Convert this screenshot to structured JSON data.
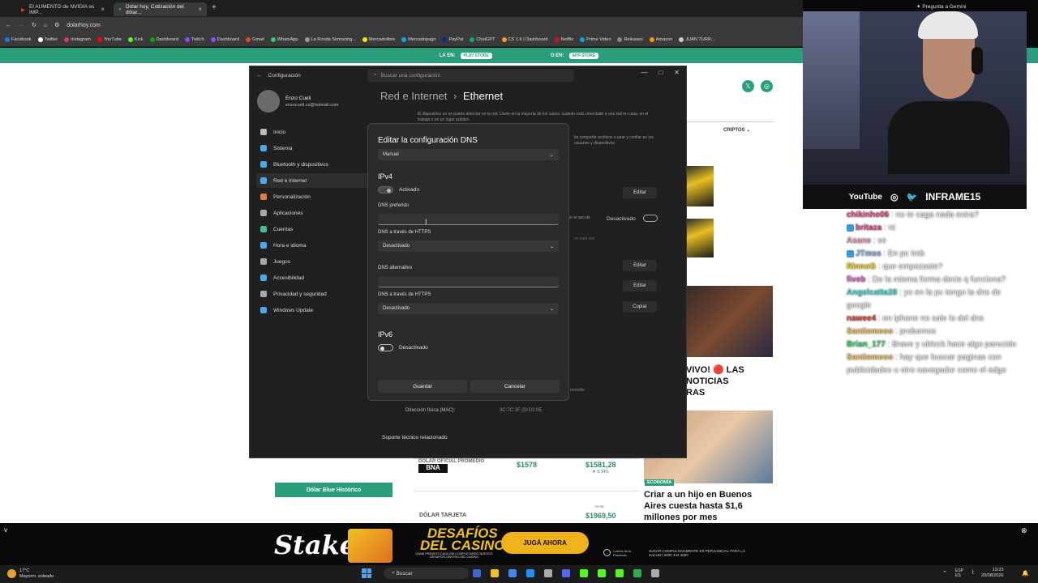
{
  "browser": {
    "tabs": [
      {
        "label": "El AUMENTO de NVIDIA es IMP..."
      },
      {
        "label": "Dólar hoy, Cotización del dólar..."
      }
    ],
    "url": "dolarhoy.com",
    "bookmarks": [
      "Facebook",
      "Twitter",
      "Instagram",
      "YouTube",
      "Kick",
      "Dashboard",
      "Twitch",
      "Dashboard",
      "Gmail",
      "WhatsApp",
      "La Ronda Simracing...",
      "Mercadolibre",
      "Mercadopago",
      "PayPal",
      "ChatGPT",
      "CS 1.6 | Dashboard",
      "Netflix",
      "Prime Video",
      "Releases",
      "Amazon",
      "JUAN TURR..."
    ]
  },
  "website": {
    "banner_left": "LA EN:",
    "banner_left_pill": "PLAY STORE",
    "banner_right": "O EN:",
    "banner_right_pill": "APP STORE",
    "cripto": "CRIPTOS",
    "blue_button": "Dólar Blue Histórico",
    "row1_label": "DÓLAR OFICIAL PROMEDIO",
    "row1_buy": "$1578",
    "row1_sell": "$1581,28",
    "row1_var": "▼ 0.34%",
    "row2_label": "DÓLAR TARJETA",
    "row2_sell_label": "Venta",
    "row2_sell": "$1969,50",
    "news1": "VIVO! 🔴 LAS\nNOTICIAS\nRAS",
    "news2_tag": "ECONOMÍA",
    "news2": "Criar a un hijo en Buenos Aires cuesta hasta $1,6 millones por mes"
  },
  "settings": {
    "app_title": "Configuración",
    "search_placeholder": "Buscar una configuración",
    "user_name": "Enzo Cueli",
    "user_email": "enzocueli.cs@hotmail.com",
    "nav": [
      "Inicio",
      "Sistema",
      "Bluetooth y dispositivos",
      "Red e Internet",
      "Personalización",
      "Aplicaciones",
      "Cuentas",
      "Hora e idioma",
      "Juegos",
      "Accesibilidad",
      "Privacidad y seguridad",
      "Windows Update"
    ],
    "breadcrumb_parent": "Red e Internet",
    "breadcrumb_sep": "›",
    "breadcrumb_current": "Ethernet",
    "bg_text1": "El dispositivo no se puede detectar en la red. Úselo en la mayoría de los casos: cuando está conectado a una red en casa, en el trabajo o en un lugar público.",
    "bg_text2": "ita compartir archivos o usar y confiar en los usuarios y dispositivos",
    "bg_text3": "ucir el uso de",
    "bg_text4": "en esta red",
    "edit_label": "Editar",
    "copy_label": "Copiar",
    "toggle_state": "Desactivado",
    "mac_label": "Dirección física (MAC):",
    "mac_value": "3C:7C:3F:23:D3:0E",
    "controller": "ontroller",
    "support": "Soporte técnico relacionado"
  },
  "dialog": {
    "title": "Editar la configuración DNS",
    "mode": "Manual",
    "ipv4_title": "IPv4",
    "ipv4_state": "Activado",
    "dns_pref_label": "DNS preferido",
    "dns_pref_value": "",
    "https1_label": "DNS a través de HTTPS",
    "https1_value": "Desactivado",
    "dns_alt_label": "DNS alternativo",
    "dns_alt_value": "",
    "https2_label": "DNS a través de HTTPS",
    "https2_value": "Desactivado",
    "ipv6_title": "IPv6",
    "ipv6_state": "Desactivado",
    "save": "Guardar",
    "cancel": "Cancelar"
  },
  "stream": {
    "gemini": "Pregunta a Gemini",
    "yt": "YouTube",
    "handle": "INFRAME15",
    "chat": [
      {
        "user": "chikinho06",
        "text": "no te caga nada extra?",
        "color": "#d94a8a",
        "badge": false
      },
      {
        "user": "britaza",
        "text": "nt",
        "color": "#d94a8a",
        "badge": true
      },
      {
        "user": "Asane",
        "text": "se",
        "color": "#e8a0b0",
        "badge": false
      },
      {
        "user": "JTmss",
        "text": "En pc tmb",
        "color": "#8ab0e0",
        "badge": true
      },
      {
        "user": "RinnoG",
        "text": "que empezaste?",
        "color": "#f0d020",
        "badge": false
      },
      {
        "user": "fiveb",
        "text": "De la misma forma decis q funciona?",
        "color": "#e060c0",
        "badge": false
      },
      {
        "user": "Angelcatta28",
        "text": "yo en la pc tengo la dns de google",
        "color": "#40d8d8",
        "badge": false
      },
      {
        "user": "nawee4",
        "text": "en iphone no sale lo del dns",
        "color": "#e04040",
        "badge": false
      },
      {
        "user": "Santiemooo",
        "text": "probemos",
        "color": "#f0c060",
        "badge": false
      },
      {
        "user": "Brian_177",
        "text": "Brave y ublock hace algo parecido",
        "color": "#40d070",
        "badge": false
      },
      {
        "user": "Santiemooo",
        "text": "hay que buscar paginas con publicidades u otro navegador como el edge",
        "color": "#f0c060",
        "badge": false
      }
    ]
  },
  "ad": {
    "stake": "Stake",
    "desafios": "DESAFÍOS\nDEL CASINO",
    "desafios_sub": "GANÁ PREMIOS CADA DÍA COMPLETANDO NUEVOS DESAFÍOS DENTRO DEL CASINO",
    "cta": "JUGÁ AHORA",
    "legal": "JUGAR COMPULSIVAMENTE ES PERJUDICIAL PARA LA SALUD | 0800 444 4000",
    "lotteria": "Lotería de la Provincia"
  },
  "taskbar": {
    "temp": "17°C",
    "weather": "Mayorm. soleado",
    "search": "Buscar",
    "lang1": "ESP",
    "lang2": "ES",
    "time": "13:23",
    "date": "20/08/2026"
  }
}
